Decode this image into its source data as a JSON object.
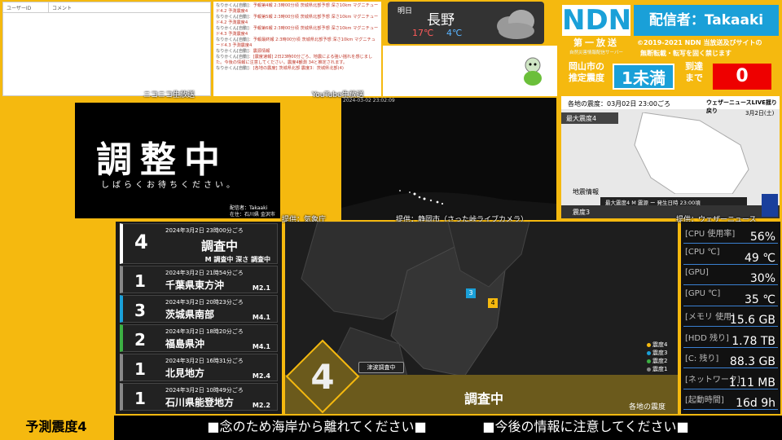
{
  "nico": {
    "col_user": "ユーザーID",
    "col_comment": "コメント",
    "caption": "ニコニコ生放送"
  },
  "youtube": {
    "caption": "YouTube生放送",
    "lines": [
      {
        "name": "なりかくん[自動]",
        "text": "予報第4報 2:3時00分頃 茨城県北部予想 深さ10km マグニチュード4.2 予測震度4"
      },
      {
        "name": "なりかくん[自動]",
        "text": "予報第5報 2:3時00分頃 茨城県北部予想 深さ10km マグニチュード4.2 予測震度4"
      },
      {
        "name": "なりかくん[自動]",
        "text": "予報第6報 2:3時00分頃 茨城県北部予想 深さ10km マグニチュード4.3 予測震度4"
      },
      {
        "name": "なりかくん[自動]",
        "text": "予報最終報 2:3時00分頃 茨城県北部予想 深さ10km マグニチュード4.3 予測震度4"
      },
      {
        "name": "なりかくん[自動]",
        "text": "震源情報"
      },
      {
        "name": "なりかくん[自動]",
        "text": "[震度速報] 2日23時00分ごろ、地震による強い揺れを感じました。今後の情報に注意してください。震度4観測 34と推定されます。"
      },
      {
        "name": "なりかくん[自動]",
        "text": "[各地の震度] 茨城県北部 震度3：茨城県北部(4)"
      }
    ]
  },
  "weather": {
    "label": "明日",
    "city": "長野",
    "high": "17℃",
    "low": "4℃"
  },
  "ndn": {
    "logo": "NDN",
    "broadcaster": "配信者：Takaaki",
    "badge": "第一放送",
    "badge_sub": "自然災害情報配信サーバー",
    "copyright": "©2019-2021 NDN 当放送及びサイトの",
    "copyright2": "無断転載・転写を固く禁じます",
    "city_label1": "岡山市の",
    "city_label2": "推定震度",
    "intensity": "1未満",
    "arrival_label1": "到達",
    "arrival_label2": "まで",
    "arrival": "0"
  },
  "adjust": {
    "title": "調整中",
    "subtitle": "しばらくお待ちください。",
    "broadcaster": "配信者：Takaaki",
    "location": "在住：石川県 金沢市",
    "caption": "提供：気象庁"
  },
  "cam": {
    "timestamp": "2024-03-02 23:02:09",
    "caption": "提供：静岡市（さった峠ライブカメラ）"
  },
  "weathernews": {
    "header": "各地の震度：03月02日 23:00ごろ",
    "brand": "ウェザーニュースLIVE揺り戻り",
    "date": "3月2日(土)",
    "max": "最大震度4",
    "info": "地震情報",
    "footer": "最大震度4 M 震源 ー 発生日時 23:00頃",
    "corner": "震度3",
    "caption": "提供：ウェザーニュース"
  },
  "quakes": [
    {
      "num": "4",
      "time": "2024年3月2日 23時00分ごろ",
      "place": "調査中",
      "mag": "M 調査中 深さ 調査中",
      "color": "#ffffff"
    },
    {
      "num": "1",
      "time": "2024年3月2日 21時54分ごろ",
      "place": "千葉県東方沖",
      "mag": "M2.1",
      "color": "#888888"
    },
    {
      "num": "3",
      "time": "2024年3月2日 20時23分ごろ",
      "place": "茨城県南部",
      "mag": "M4.1",
      "color": "#1aa0d8"
    },
    {
      "num": "2",
      "time": "2024年3月2日 18時20分ごろ",
      "place": "福島県沖",
      "mag": "M4.1",
      "color": "#3cb043"
    },
    {
      "num": "1",
      "time": "2024年3月2日 16時31分ごろ",
      "place": "北見地方",
      "mag": "M2.4",
      "color": "#888888"
    },
    {
      "num": "1",
      "time": "2024年3月2日 10時49分ごろ",
      "place": "石川県能登地方",
      "mag": "M2.2",
      "color": "#888888"
    }
  ],
  "center": {
    "big_intensity": "4",
    "tsunami": "津波調査中",
    "status": "調査中",
    "map_label": "各地の震度",
    "marker_a": "3",
    "marker_b": "4",
    "legend": [
      "震度4",
      "震度3",
      "震度2",
      "震度1"
    ]
  },
  "stats": [
    {
      "k": "[CPU 使用率]",
      "v": "56%"
    },
    {
      "k": "[CPU ℃]",
      "v": "49 ℃"
    },
    {
      "k": "[GPU]",
      "v": "30%"
    },
    {
      "k": "[GPU ℃]",
      "v": "35 ℃"
    },
    {
      "k": "[メモリ 使用]",
      "v": "15.6 GB"
    },
    {
      "k": "[HDD 残り]",
      "v": "1.78 TB"
    },
    {
      "k": "[C: 残り]",
      "v": "88.3 GB"
    },
    {
      "k": "[ネットワーク]",
      "v": "1.11 MB"
    },
    {
      "k": "[起動時間]",
      "v": "16d 9h"
    }
  ],
  "bottom": {
    "forecast": "予測震度4",
    "msg1": "■念のため海岸から離れてください■",
    "msg2": "■今後の情報に注意してください■"
  }
}
